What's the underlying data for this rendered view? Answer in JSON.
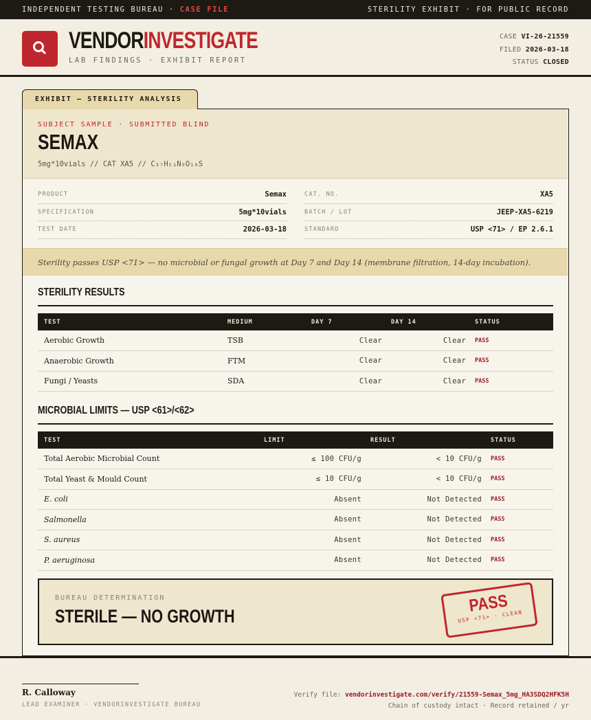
{
  "topbar": {
    "left_prefix": "INDEPENDENT TESTING BUREAU · ",
    "left_highlight": "CASE FILE",
    "right": "STERILITY EXHIBIT · FOR PUBLIC RECORD"
  },
  "header": {
    "logo_icon": "magnifier-icon",
    "brand_part1": "VENDOR",
    "brand_part2": "INVESTIGATE",
    "subtitle": "LAB FINDINGS · EXHIBIT REPORT",
    "case_label": "CASE",
    "case_value": "VI-26-21559",
    "filed_label": "FILED",
    "filed_value": "2026-03-18",
    "status_label": "STATUS",
    "status_value": "CLOSED"
  },
  "exhibit": {
    "tab_label": "EXHIBIT — STERILITY ANALYSIS",
    "subject_tag": "SUBJECT SAMPLE · SUBMITTED BLIND",
    "subject_title": "SEMAX",
    "subject_desc": "5mg*10vials  //  CAT XA5  //  C₃₇H₅₁N₉O₁₀S"
  },
  "specs": {
    "left": [
      {
        "key": "PRODUCT",
        "value": "Semax"
      },
      {
        "key": "SPECIFICATION",
        "value": "5mg*10vials"
      },
      {
        "key": "TEST DATE",
        "value": "2026-03-18"
      }
    ],
    "right": [
      {
        "key": "CAT. NO.",
        "value": "XA5"
      },
      {
        "key": "BATCH / LOT",
        "value": "JEEP-XA5-6219"
      },
      {
        "key": "STANDARD",
        "value": "USP <71> / EP 2.6.1"
      }
    ]
  },
  "note": "Sterility passes USP <71> — no microbial or fungal growth at Day 7 and Day 14 (membrane filtration, 14-day incubation).",
  "sterility": {
    "title": "STERILITY RESULTS",
    "headers": [
      "TEST",
      "MEDIUM",
      "DAY 7",
      "DAY 14",
      "STATUS"
    ],
    "rows": [
      {
        "test": "Aerobic Growth",
        "medium": "TSB",
        "day7": "Clear",
        "day14": "Clear",
        "status": "PASS"
      },
      {
        "test": "Anaerobic Growth",
        "medium": "FTM",
        "day7": "Clear",
        "day14": "Clear",
        "status": "PASS"
      },
      {
        "test": "Fungi / Yeasts",
        "medium": "SDA",
        "day7": "Clear",
        "day14": "Clear",
        "status": "PASS"
      }
    ]
  },
  "microbial": {
    "title": "MICROBIAL LIMITS — USP <61>/<62>",
    "headers": [
      "TEST",
      "LIMIT",
      "RESULT",
      "STATUS"
    ],
    "rows": [
      {
        "test": "Total Aerobic Microbial Count",
        "limit": "≤ 100 CFU/g",
        "result": "< 10 CFU/g",
        "status": "PASS"
      },
      {
        "test": "Total Yeast & Mould Count",
        "limit": "≤ 10 CFU/g",
        "result": "< 10 CFU/g",
        "status": "PASS"
      },
      {
        "test": "E. coli",
        "limit": "Absent",
        "result": "Not Detected",
        "status": "PASS"
      },
      {
        "test": "Salmonella",
        "limit": "Absent",
        "result": "Not Detected",
        "status": "PASS"
      },
      {
        "test": "S. aureus",
        "limit": "Absent",
        "result": "Not Detected",
        "status": "PASS"
      },
      {
        "test": "P. aeruginosa",
        "limit": "Absent",
        "result": "Not Detected",
        "status": "PASS"
      }
    ]
  },
  "determination": {
    "label": "BUREAU DETERMINATION",
    "value": "STERILE — NO GROWTH",
    "stamp_main": "PASS",
    "stamp_sub": "USP <71> · CLEAN"
  },
  "footer": {
    "examiner_name": "R. Calloway",
    "examiner_title": "LEAD EXAMINER · VENDORINVESTIGATE BUREAU",
    "verify_label": "Verify file: ",
    "verify_link": "vendorinvestigate.com/verify/21559-Semax_5mg_HA3SDQ2HFK5H",
    "custody": "Chain of custody intact · Record retained / yr"
  },
  "colors": {
    "accent": "#c0262d",
    "ink": "#1d1a14",
    "paper": "#f3eee2",
    "highlight": "#e7d9ab"
  }
}
